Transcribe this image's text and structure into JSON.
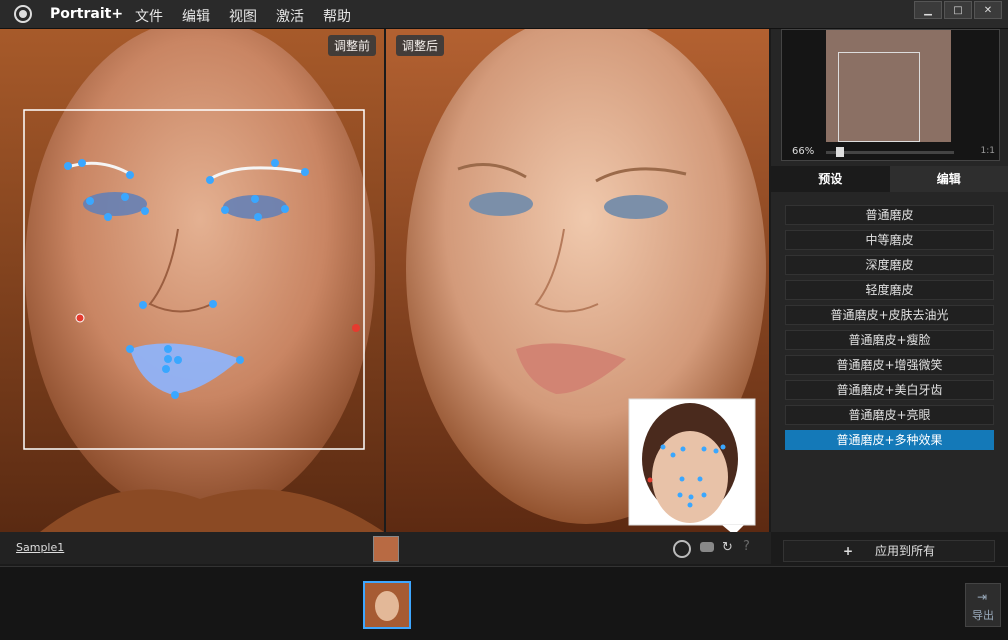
{
  "app": {
    "title": "Portrait+",
    "logo_icon": "camera-lens-icon"
  },
  "menu": [
    "文件",
    "编辑",
    "视图",
    "激活",
    "帮助"
  ],
  "window_controls": [
    "minimize",
    "maximize",
    "close"
  ],
  "views": {
    "before_label": "调整前",
    "after_label": "调整后"
  },
  "navigator": {
    "zoom": "66%",
    "fit_label": "1:1"
  },
  "tabs": [
    "预设",
    "编辑"
  ],
  "presets": [
    "普通磨皮",
    "中等磨皮",
    "深度磨皮",
    "轻度磨皮",
    "普通磨皮+皮肤去油光",
    "普通磨皮+瘦脸",
    "普通磨皮+增强微笑",
    "普通磨皮+美白牙齿",
    "普通磨皮+亮眼",
    "普通磨皮+多种效果"
  ],
  "selected_preset_index": 9,
  "file": {
    "name": "Sample1"
  },
  "status_icons": [
    "face-detect-icon",
    "mask-icon",
    "reset-icon",
    "help-icon"
  ],
  "apply_all": {
    "label": "应用到所有",
    "icon": "plus-icon"
  },
  "export": {
    "label": "导出",
    "icon": "export-icon"
  },
  "colors": {
    "accent": "#1479b8",
    "landmark": "#3aa7ff",
    "lip_overlay": "#8db5ff"
  }
}
